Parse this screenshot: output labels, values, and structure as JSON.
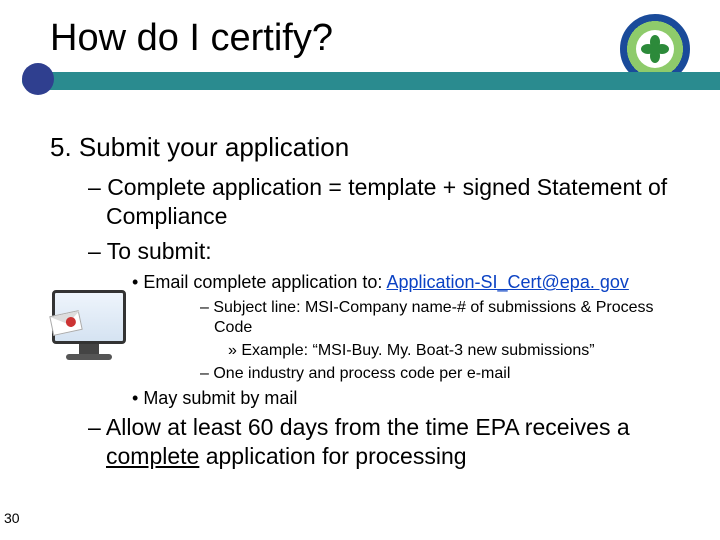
{
  "title": "How do I certify?",
  "section": {
    "number": "5.",
    "heading": "Submit your application"
  },
  "bullets": {
    "b1": "Complete application = template + signed Statement of Compliance",
    "b2": "To submit:",
    "b2a_prefix": "Email complete application to:  ",
    "b2a_email": "Application-SI_Cert@epa. gov",
    "b2a1": "Subject line: MSI-Company name-# of submissions & Process Code",
    "b2a1a": "Example:  “MSI-Buy. My. Boat-3 new submissions”",
    "b2a2": "One industry and process code per e-mail",
    "b2b": "May submit by mail",
    "b3_pre": "Allow at least 60 days from the time EPA receives a ",
    "b3_u": "complete",
    "b3_post": " application for processing"
  },
  "page_number": "30",
  "logo_alt": "EPA seal"
}
